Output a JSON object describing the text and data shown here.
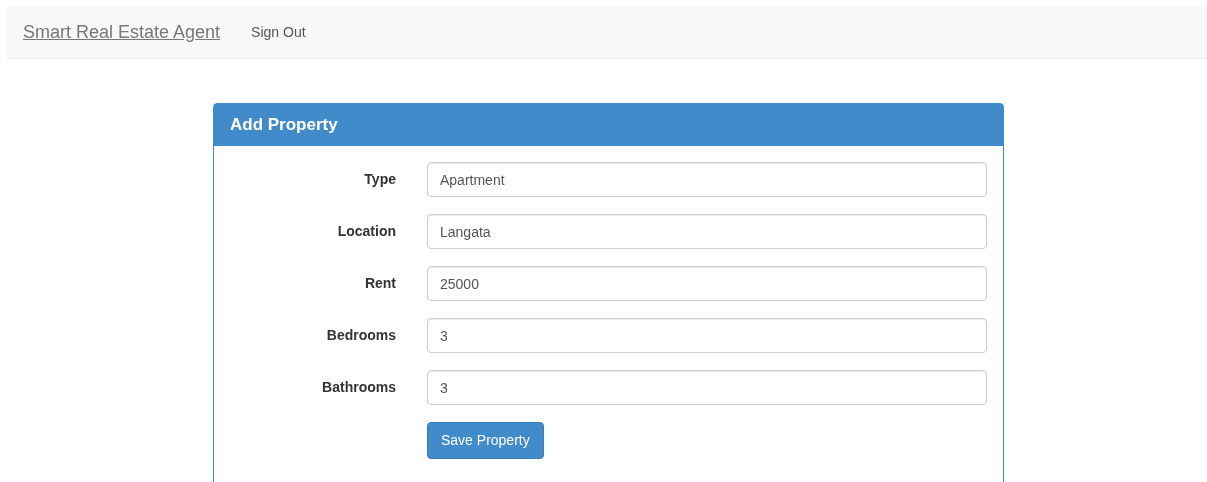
{
  "navbar": {
    "brand": "Smart Real Estate Agent",
    "links": [
      "Sign Out"
    ]
  },
  "panel": {
    "title": "Add Property",
    "fields": [
      {
        "label": "Type",
        "value": "Apartment"
      },
      {
        "label": "Location",
        "value": "Langata"
      },
      {
        "label": "Rent",
        "value": "25000"
      },
      {
        "label": "Bedrooms",
        "value": "3"
      },
      {
        "label": "Bathrooms",
        "value": "3"
      }
    ],
    "submit": "Save Property"
  }
}
